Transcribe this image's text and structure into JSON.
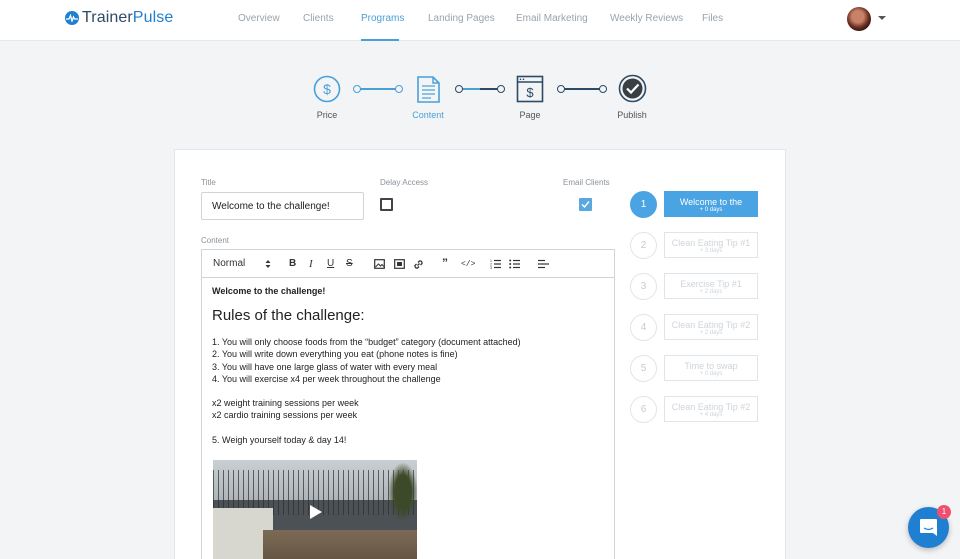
{
  "brand": {
    "name_prefix": "Trainer",
    "name_suffix": "Pulse",
    "accent": "#1f7fd0",
    "logo_icon": "pulse-heart-icon"
  },
  "nav": {
    "items": [
      "Overview",
      "Clients",
      "Programs",
      "Landing Pages",
      "Email Marketing",
      "Weekly Reviews",
      "Files"
    ],
    "active": "Programs"
  },
  "stepper": {
    "steps": [
      {
        "label": "Price",
        "icon": "dollar-circle-icon"
      },
      {
        "label": "Content",
        "icon": "document-icon",
        "active": true
      },
      {
        "label": "Page",
        "icon": "page-dollar-icon"
      },
      {
        "label": "Publish",
        "icon": "check-circle-icon"
      }
    ]
  },
  "form": {
    "title_label": "Title",
    "title_value": "Welcome to the challenge!",
    "delay_label": "Delay Access",
    "delay_checked": false,
    "email_label": "Email Clients",
    "email_checked": true,
    "content_label": "Content"
  },
  "editor": {
    "format": "Normal",
    "toolbar_icons": [
      "bold-icon",
      "italic-icon",
      "underline-icon",
      "strikethrough-icon",
      "image-icon",
      "video-icon",
      "link-icon",
      "quote-icon",
      "code-icon",
      "ordered-list-icon",
      "bullet-list-icon",
      "align-icon"
    ],
    "heading": "Welcome to the challenge!",
    "subheading": "Rules of the challenge:",
    "rules": [
      "1. You will only choose foods from the “budget” category (document attached)",
      "2. You will write down everything you eat (phone notes is fine)",
      "3. You will have one large glass of water with every meal",
      "4. You will exercise x4 per week throughout the challenge"
    ],
    "training": [
      "x2 weight training sessions per week",
      "x2 cardio training sessions per week"
    ],
    "weigh_in": "5. Weigh yourself today & day 14!",
    "video_icon": "play-icon"
  },
  "sequence": [
    {
      "num": "1",
      "title": "Welcome to the",
      "delay": "+ 0 days",
      "active": true
    },
    {
      "num": "2",
      "title": "Clean Eating Tip #1",
      "delay": "+ 3 days"
    },
    {
      "num": "3",
      "title": "Exercise Tip #1",
      "delay": "+ 2 days"
    },
    {
      "num": "4",
      "title": "Clean Eating Tip #2",
      "delay": "+ 2 days"
    },
    {
      "num": "5",
      "title": "Time to swap",
      "delay": "+ 0 days"
    },
    {
      "num": "6",
      "title": "Clean Eating Tip #2",
      "delay": "+ 4 days"
    }
  ],
  "chat": {
    "badge": "1",
    "icon": "chat-icon"
  }
}
